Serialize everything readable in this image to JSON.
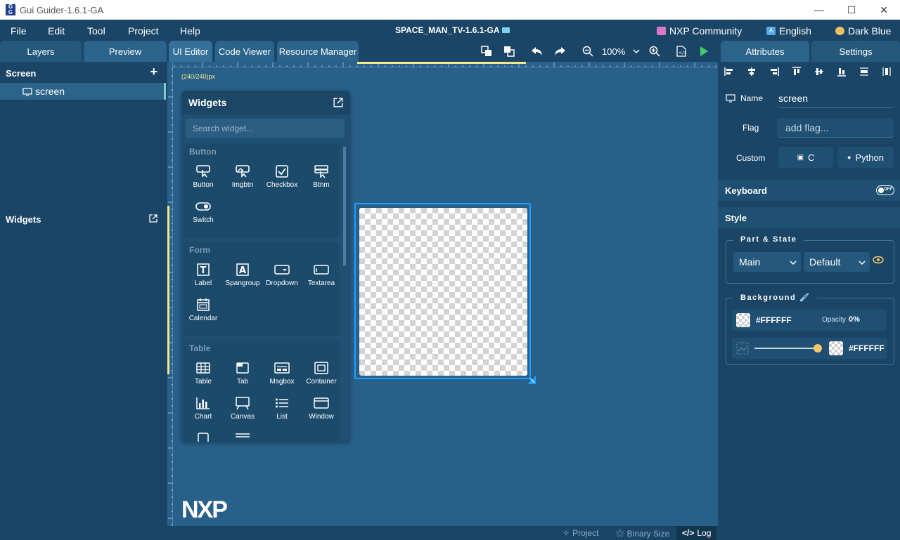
{
  "window": {
    "title": "Gui Guider-1.6.1-GA",
    "app_icon_text": "G\nG"
  },
  "menu": {
    "items": [
      "File",
      "Edit",
      "Tool",
      "Project",
      "Help"
    ],
    "project_title": "SPACE_MAN_TV-1.6.1-GA",
    "community": "NXP Community",
    "language": "English",
    "theme": "Dark Blue"
  },
  "left_tabs": [
    "Layers",
    "Preview"
  ],
  "editor_tabs": [
    "UI Editor",
    "Code Viewer",
    "Resource Manager"
  ],
  "zoom": "100%",
  "screens": {
    "header": "Screen",
    "items": [
      "screen"
    ]
  },
  "widgets_sidebar": {
    "header": "Widgets"
  },
  "canvas": {
    "dimension_label": "(240/240)px"
  },
  "widgets_panel": {
    "title": "Widgets",
    "search_placeholder": "Search widget...",
    "groups": [
      {
        "title": "Button",
        "items": [
          "Button",
          "Imgbtn",
          "Checkbox",
          "Btnm",
          "Switch"
        ]
      },
      {
        "title": "Form",
        "items": [
          "Label",
          "Spangroup",
          "Dropdown",
          "Textarea",
          "Calendar"
        ]
      },
      {
        "title": "Table",
        "items": [
          "Table",
          "Tab",
          "Msgbox",
          "Container",
          "Chart",
          "Canvas",
          "List",
          "Window"
        ]
      }
    ]
  },
  "logo_text": "NXP",
  "status_bar": {
    "project": "Project",
    "binary_size": "Binary Size",
    "log": "Log"
  },
  "right_tabs": [
    "Attributes",
    "Settings"
  ],
  "attributes": {
    "name_label": "Name",
    "name_value": "screen",
    "flag_label": "Flag",
    "flag_placeholder": "add flag...",
    "custom_label": "Custom",
    "custom_c": "C",
    "custom_python": "Python",
    "keyboard_label": "Keyboard",
    "keyboard_toggle": "OFF",
    "style_label": "Style",
    "part_state_title": "Part & State",
    "part_value": "Main",
    "state_value": "Default",
    "background_title": "Background",
    "bg_color": "#FFFFFF",
    "opacity_label": "Opacity",
    "opacity_value": "0%",
    "grad_color": "#FFFFFF"
  },
  "colors": {
    "accent_selection": "#1e9fff",
    "ruler_highlight": "#f2e98a",
    "play_green": "#3ecf6b"
  }
}
